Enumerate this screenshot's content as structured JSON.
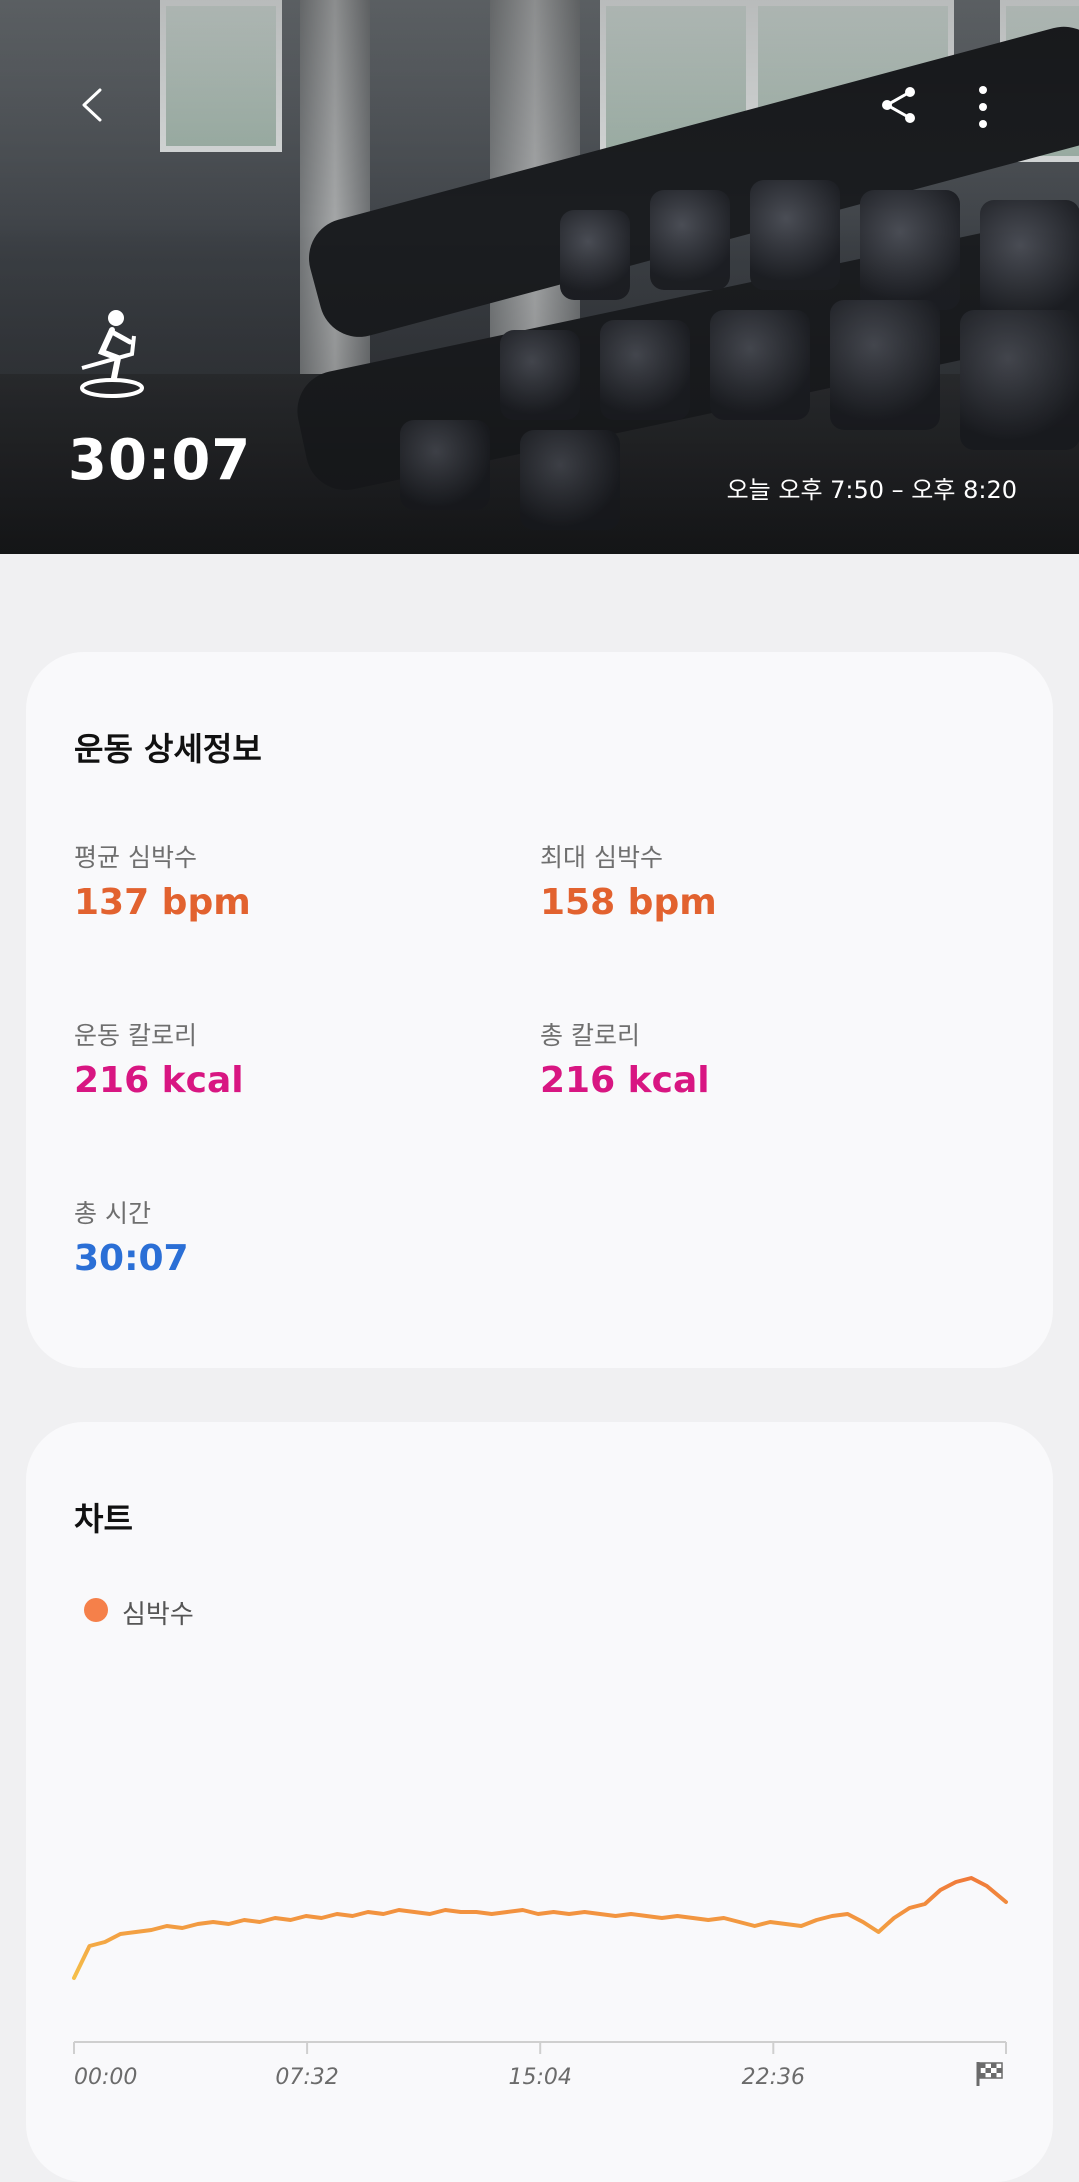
{
  "header": {
    "duration": "30:07",
    "time_range": "오늘 오후 7:50 – 오후 8:20",
    "icons": [
      "back-icon",
      "share-icon",
      "more-icon",
      "exercise-bike-icon"
    ]
  },
  "details": {
    "title": "운동 상세정보",
    "stats": [
      {
        "label": "평균 심박수",
        "value": "137 bpm",
        "color": "#e2622f"
      },
      {
        "label": "최대 심박수",
        "value": "158 bpm",
        "color": "#e2622f"
      },
      {
        "label": "운동 칼로리",
        "value": "216 kcal",
        "color": "#d81682"
      },
      {
        "label": "총 칼로리",
        "value": "216 kcal",
        "color": "#d81682"
      },
      {
        "label": "총 시간",
        "value": "30:07",
        "color": "#2b6fd6"
      }
    ]
  },
  "chart_section": {
    "title": "차트",
    "legend": "심박수",
    "legend_color": "#f5804a"
  },
  "chart_data": {
    "type": "line",
    "x_tick_labels": [
      "00:00",
      "07:32",
      "15:04",
      "22:36"
    ],
    "end_marker": "finish-flag-icon",
    "series": [
      {
        "name": "심박수",
        "x": [
          0,
          0.5,
          1,
          1.5,
          2,
          2.5,
          3,
          3.5,
          4,
          4.5,
          5,
          5.5,
          6,
          6.5,
          7,
          7.5,
          8,
          8.5,
          9,
          9.5,
          10,
          10.5,
          11,
          11.5,
          12,
          12.5,
          13,
          13.5,
          14,
          14.5,
          15,
          15.5,
          16,
          16.5,
          17,
          17.5,
          18,
          18.5,
          19,
          19.5,
          20,
          20.5,
          21,
          21.5,
          22,
          22.5,
          23,
          23.5,
          24,
          24.5,
          25,
          25.5,
          26,
          26.5,
          27,
          27.5,
          28,
          28.5,
          29,
          29.5,
          30.12
        ],
        "values": [
          102,
          118,
          120,
          124,
          125,
          126,
          128,
          127,
          129,
          130,
          129,
          131,
          130,
          132,
          131,
          133,
          132,
          134,
          133,
          135,
          134,
          136,
          135,
          134,
          136,
          135,
          135,
          134,
          135,
          136,
          134,
          135,
          134,
          135,
          134,
          133,
          134,
          133,
          132,
          133,
          132,
          131,
          132,
          130,
          128,
          130,
          129,
          128,
          131,
          133,
          134,
          130,
          125,
          132,
          137,
          139,
          146,
          150,
          152,
          148,
          140
        ],
        "colors": [
          "#f5c04a",
          "#f07a3a"
        ]
      }
    ]
  }
}
